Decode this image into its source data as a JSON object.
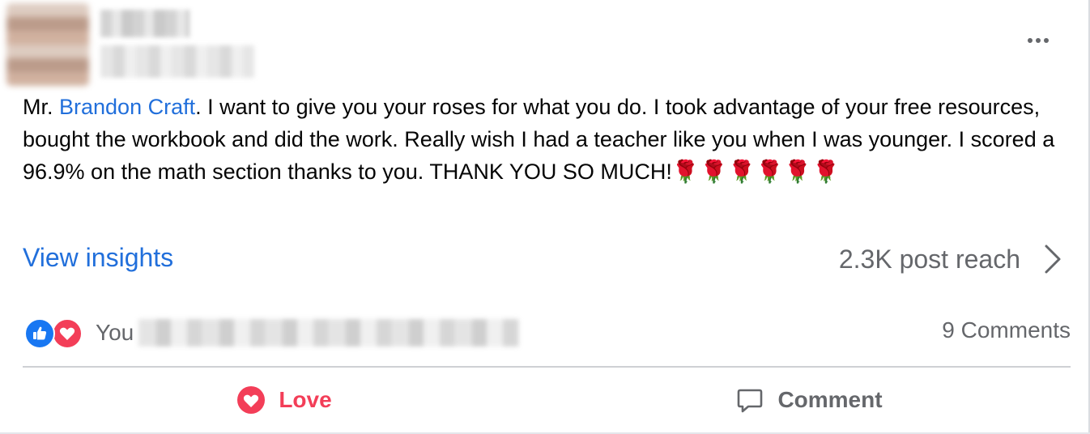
{
  "post": {
    "text_before": "Mr. ",
    "mention": "Brandon Craft",
    "text_after": ".  I want to give you your roses for what you do.  I took advantage of your free resources, bought the workbook and did the work.  Really wish I had a teacher like you when I was younger.  I scored a 96.9% on the math section thanks to you.  THANK YOU SO MUCH!",
    "emoji": "🌹🌹🌹🌹🌹🌹"
  },
  "insights": {
    "view_label": "View insights",
    "reach_label": "2.3K post reach"
  },
  "reactions": {
    "you_label": "You",
    "comments_label": "9 Comments"
  },
  "actions": {
    "love_label": "Love",
    "comment_label": "Comment"
  },
  "colors": {
    "link": "#216fdb",
    "love": "#f33e58",
    "like": "#1877f2",
    "muted": "#65676b"
  },
  "icons": [
    "more-options-icon",
    "chevron-right-icon",
    "like-reaction-icon",
    "love-reaction-icon",
    "heart-icon",
    "comment-icon"
  ]
}
